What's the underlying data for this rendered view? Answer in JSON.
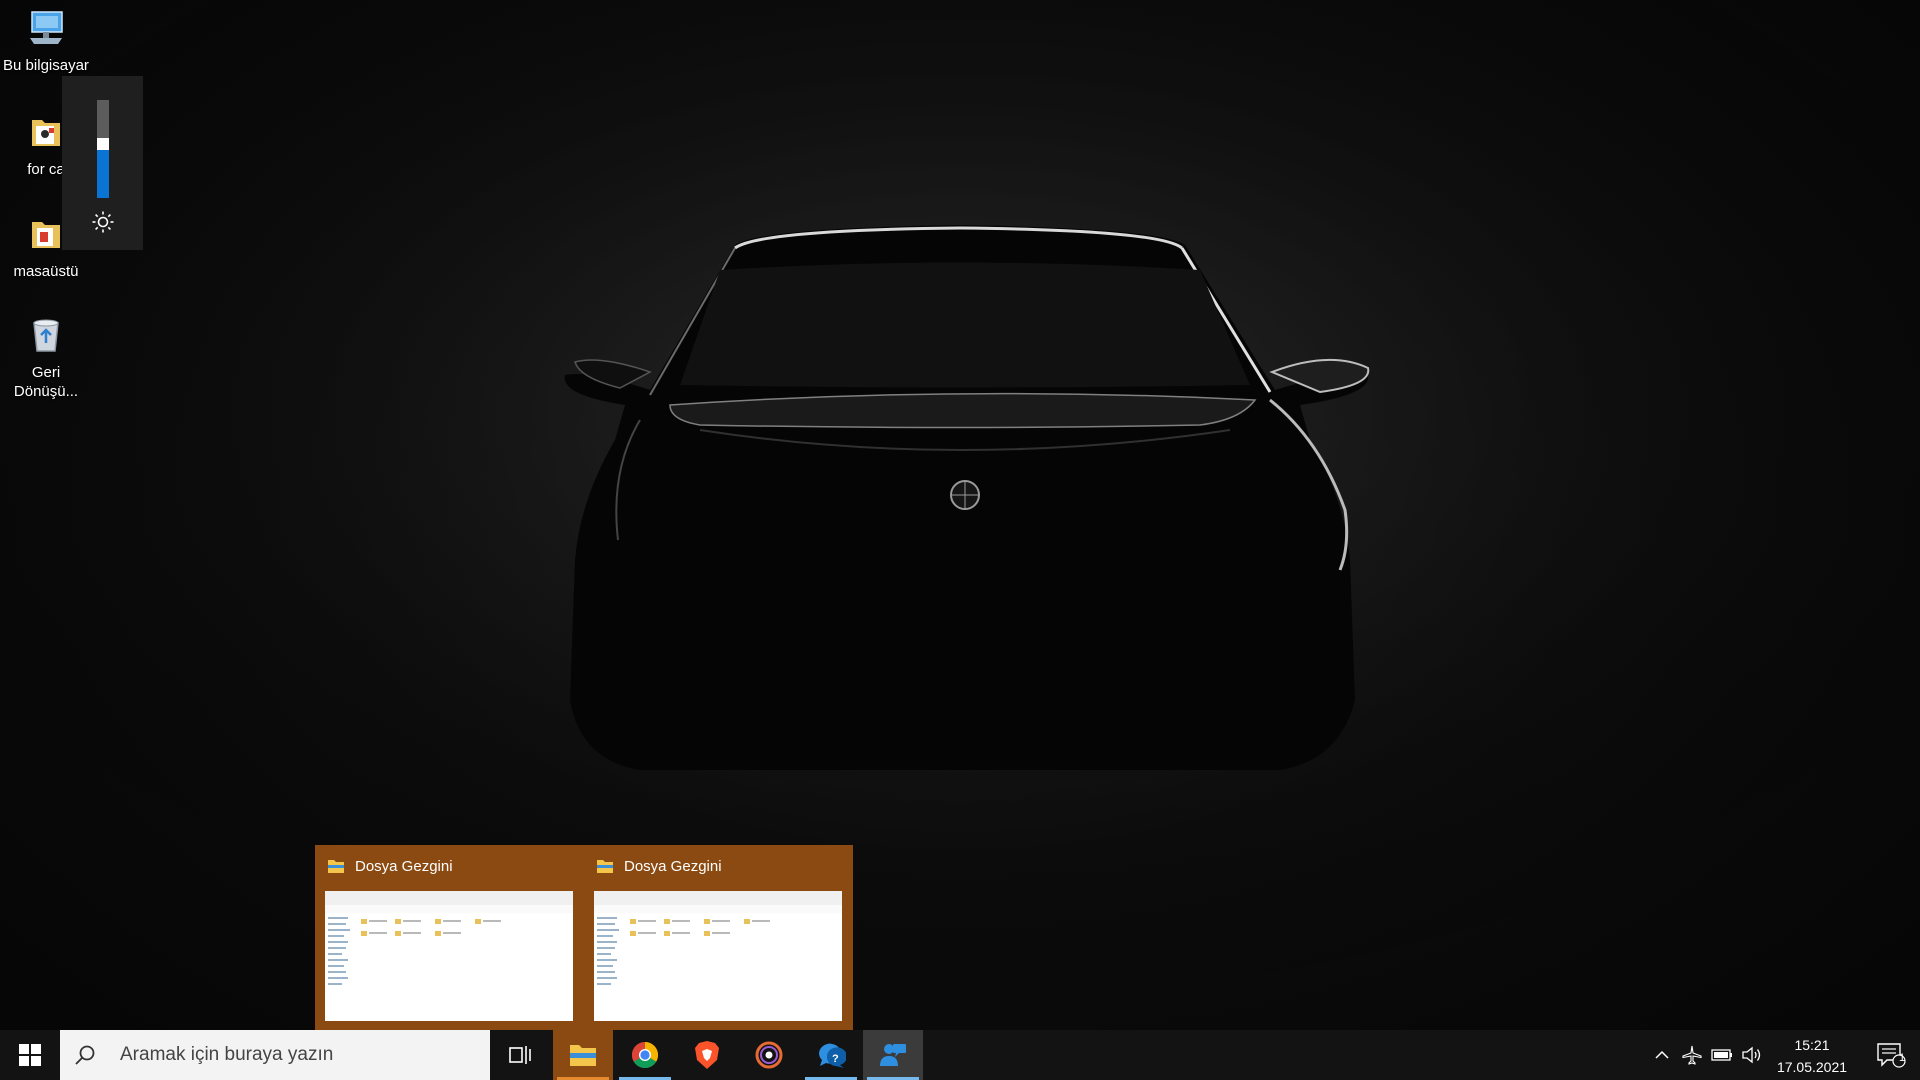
{
  "desktop": {
    "icons": [
      {
        "label": "Bu bilgisayar",
        "icon": "computer-icon"
      },
      {
        "label": "for ca",
        "icon": "folder-icon"
      },
      {
        "label": "masaüstü",
        "icon": "folder-icon"
      },
      {
        "label": "Geri",
        "label2": "Dönüşü...",
        "icon": "recycle-bin-icon"
      }
    ]
  },
  "brightness": {
    "level_percent": 55,
    "icon": "sun-icon"
  },
  "previews": [
    {
      "title": "Dosya Gezgini",
      "icon": "file-explorer-icon"
    },
    {
      "title": "Dosya Gezgini",
      "icon": "file-explorer-icon"
    }
  ],
  "taskbar": {
    "search_placeholder": "Aramak için buraya yazın",
    "apps": [
      "task-view-icon",
      "file-explorer-icon",
      "chrome-icon",
      "brave-icon",
      "media-player-icon",
      "get-help-icon",
      "people-icon"
    ],
    "clock": {
      "time": "15:21",
      "date": "17.05.2021"
    },
    "notification_count": "1"
  },
  "colors": {
    "accent_orange": "#8a4a11",
    "accent_blue": "#0a74d4",
    "taskbar": "#131313"
  }
}
